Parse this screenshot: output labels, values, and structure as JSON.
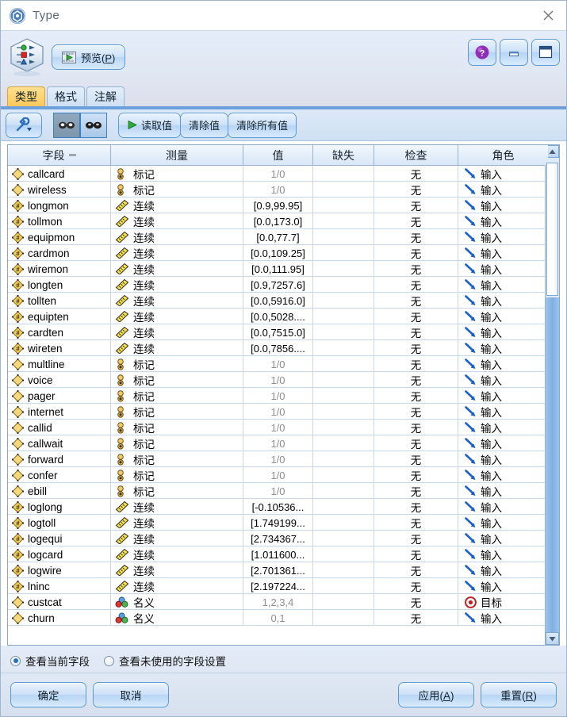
{
  "window": {
    "title": "Type",
    "icon": "spss-node-icon",
    "close_label": "close-icon"
  },
  "header": {
    "node_icon": "type-node-icon",
    "preview_label": "预览(P)",
    "help_label": "?",
    "minimize_label": "minimize-icon",
    "maximize_label": "maximize-icon"
  },
  "tabs": [
    {
      "label": "类型",
      "active": true
    },
    {
      "label": "格式",
      "active": false
    },
    {
      "label": "注解",
      "active": false
    }
  ],
  "toolbar": {
    "wrench_label": "wrench-icon",
    "glasses_pressed_label": "glasses-filter-on",
    "glasses_normal_label": "glasses-filter-off",
    "read_values_label": "读取值",
    "clear_values_label": "清除值",
    "clear_all_values_label": "清除所有值"
  },
  "table": {
    "columns": [
      {
        "key": "field",
        "label": "字段",
        "sort": true
      },
      {
        "key": "measure",
        "label": "测量"
      },
      {
        "key": "values",
        "label": "值"
      },
      {
        "key": "missing",
        "label": "缺失"
      },
      {
        "key": "check",
        "label": "检查"
      },
      {
        "key": "role",
        "label": "角色"
      }
    ],
    "rows": [
      {
        "field": "callcard",
        "ftype": "flag",
        "measure": "标记",
        "micon": "flag",
        "values": "1/0",
        "muted": true,
        "missing": "",
        "check": "无",
        "role": "输入",
        "ricon": "input"
      },
      {
        "field": "wireless",
        "ftype": "flag",
        "measure": "标记",
        "micon": "flag",
        "values": "1/0",
        "muted": true,
        "missing": "",
        "check": "无",
        "role": "输入",
        "ricon": "input"
      },
      {
        "field": "longmon",
        "ftype": "cont",
        "measure": "连续",
        "micon": "ruler",
        "values": "[0.9,99.95]",
        "muted": false,
        "missing": "",
        "check": "无",
        "role": "输入",
        "ricon": "input"
      },
      {
        "field": "tollmon",
        "ftype": "cont",
        "measure": "连续",
        "micon": "ruler",
        "values": "[0.0,173.0]",
        "muted": false,
        "missing": "",
        "check": "无",
        "role": "输入",
        "ricon": "input"
      },
      {
        "field": "equipmon",
        "ftype": "cont",
        "measure": "连续",
        "micon": "ruler",
        "values": "[0.0,77.7]",
        "muted": false,
        "missing": "",
        "check": "无",
        "role": "输入",
        "ricon": "input"
      },
      {
        "field": "cardmon",
        "ftype": "cont",
        "measure": "连续",
        "micon": "ruler",
        "values": "[0.0,109.25]",
        "muted": false,
        "missing": "",
        "check": "无",
        "role": "输入",
        "ricon": "input"
      },
      {
        "field": "wiremon",
        "ftype": "cont",
        "measure": "连续",
        "micon": "ruler",
        "values": "[0.0,111.95]",
        "muted": false,
        "missing": "",
        "check": "无",
        "role": "输入",
        "ricon": "input"
      },
      {
        "field": "longten",
        "ftype": "cont",
        "measure": "连续",
        "micon": "ruler",
        "values": "[0.9,7257.6]",
        "muted": false,
        "missing": "",
        "check": "无",
        "role": "输入",
        "ricon": "input"
      },
      {
        "field": "tollten",
        "ftype": "cont",
        "measure": "连续",
        "micon": "ruler",
        "values": "[0.0,5916.0]",
        "muted": false,
        "missing": "",
        "check": "无",
        "role": "输入",
        "ricon": "input"
      },
      {
        "field": "equipten",
        "ftype": "cont",
        "measure": "连续",
        "micon": "ruler",
        "values": "[0.0,5028....",
        "muted": false,
        "missing": "",
        "check": "无",
        "role": "输入",
        "ricon": "input"
      },
      {
        "field": "cardten",
        "ftype": "cont",
        "measure": "连续",
        "micon": "ruler",
        "values": "[0.0,7515.0]",
        "muted": false,
        "missing": "",
        "check": "无",
        "role": "输入",
        "ricon": "input"
      },
      {
        "field": "wireten",
        "ftype": "cont",
        "measure": "连续",
        "micon": "ruler",
        "values": "[0.0,7856....",
        "muted": false,
        "missing": "",
        "check": "无",
        "role": "输入",
        "ricon": "input"
      },
      {
        "field": "multline",
        "ftype": "flag",
        "measure": "标记",
        "micon": "flag",
        "values": "1/0",
        "muted": true,
        "missing": "",
        "check": "无",
        "role": "输入",
        "ricon": "input"
      },
      {
        "field": "voice",
        "ftype": "flag",
        "measure": "标记",
        "micon": "flag",
        "values": "1/0",
        "muted": true,
        "missing": "",
        "check": "无",
        "role": "输入",
        "ricon": "input"
      },
      {
        "field": "pager",
        "ftype": "flag",
        "measure": "标记",
        "micon": "flag",
        "values": "1/0",
        "muted": true,
        "missing": "",
        "check": "无",
        "role": "输入",
        "ricon": "input"
      },
      {
        "field": "internet",
        "ftype": "flag",
        "measure": "标记",
        "micon": "flag",
        "values": "1/0",
        "muted": true,
        "missing": "",
        "check": "无",
        "role": "输入",
        "ricon": "input"
      },
      {
        "field": "callid",
        "ftype": "flag",
        "measure": "标记",
        "micon": "flag",
        "values": "1/0",
        "muted": true,
        "missing": "",
        "check": "无",
        "role": "输入",
        "ricon": "input"
      },
      {
        "field": "callwait",
        "ftype": "flag",
        "measure": "标记",
        "micon": "flag",
        "values": "1/0",
        "muted": true,
        "missing": "",
        "check": "无",
        "role": "输入",
        "ricon": "input"
      },
      {
        "field": "forward",
        "ftype": "flag",
        "measure": "标记",
        "micon": "flag",
        "values": "1/0",
        "muted": true,
        "missing": "",
        "check": "无",
        "role": "输入",
        "ricon": "input"
      },
      {
        "field": "confer",
        "ftype": "flag",
        "measure": "标记",
        "micon": "flag",
        "values": "1/0",
        "muted": true,
        "missing": "",
        "check": "无",
        "role": "输入",
        "ricon": "input"
      },
      {
        "field": "ebill",
        "ftype": "flag",
        "measure": "标记",
        "micon": "flag",
        "values": "1/0",
        "muted": true,
        "missing": "",
        "check": "无",
        "role": "输入",
        "ricon": "input"
      },
      {
        "field": "loglong",
        "ftype": "cont",
        "measure": "连续",
        "micon": "ruler",
        "values": "[-0.10536...",
        "muted": false,
        "missing": "",
        "check": "无",
        "role": "输入",
        "ricon": "input"
      },
      {
        "field": "logtoll",
        "ftype": "cont",
        "measure": "连续",
        "micon": "ruler",
        "values": "[1.749199...",
        "muted": false,
        "missing": "",
        "check": "无",
        "role": "输入",
        "ricon": "input"
      },
      {
        "field": "logequi",
        "ftype": "cont",
        "measure": "连续",
        "micon": "ruler",
        "values": "[2.734367...",
        "muted": false,
        "missing": "",
        "check": "无",
        "role": "输入",
        "ricon": "input"
      },
      {
        "field": "logcard",
        "ftype": "cont",
        "measure": "连续",
        "micon": "ruler",
        "values": "[1.011600...",
        "muted": false,
        "missing": "",
        "check": "无",
        "role": "输入",
        "ricon": "input"
      },
      {
        "field": "logwire",
        "ftype": "cont",
        "measure": "连续",
        "micon": "ruler",
        "values": "[2.701361...",
        "muted": false,
        "missing": "",
        "check": "无",
        "role": "输入",
        "ricon": "input"
      },
      {
        "field": "lninc",
        "ftype": "cont",
        "measure": "连续",
        "micon": "ruler",
        "values": "[2.197224...",
        "muted": false,
        "missing": "",
        "check": "无",
        "role": "输入",
        "ricon": "input"
      },
      {
        "field": "custcat",
        "ftype": "nom",
        "measure": "名义",
        "micon": "balls",
        "values": "1,2,3,4",
        "muted": true,
        "missing": "",
        "check": "无",
        "role": "目标",
        "ricon": "target"
      },
      {
        "field": "churn",
        "ftype": "nom",
        "measure": "名义",
        "micon": "balls",
        "values": "0,1",
        "muted": true,
        "missing": "",
        "check": "无",
        "role": "输入",
        "ricon": "input"
      }
    ]
  },
  "view_options": [
    {
      "label": "查看当前字段",
      "selected": true
    },
    {
      "label": "查看未使用的字段设置",
      "selected": false
    }
  ],
  "footer": {
    "ok_label": "确定",
    "cancel_label": "取消",
    "apply_label": "应用(A)",
    "apply_mnemonic": "A",
    "reset_label": "重置(R)",
    "reset_mnemonic": "R"
  },
  "colors": {
    "accent": "#5b9bd5",
    "active_tab": "#fbc95a",
    "target_role": "#d02020",
    "input_role": "#1a62c9"
  }
}
